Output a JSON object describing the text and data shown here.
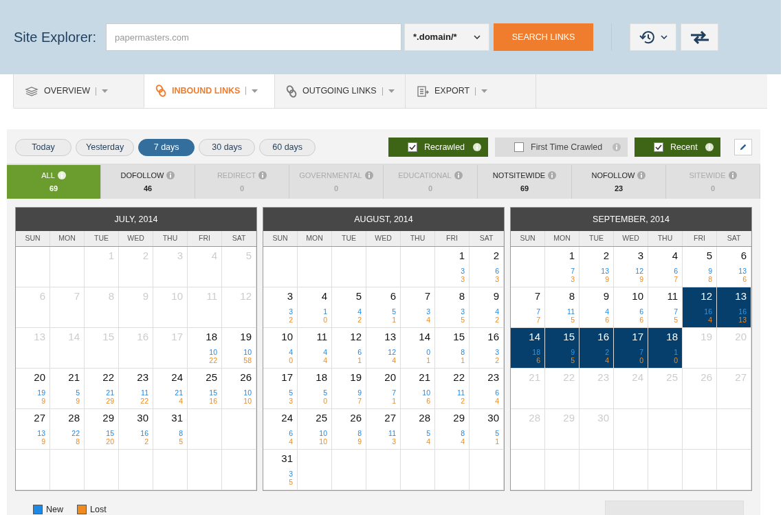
{
  "header": {
    "title": "Site Explorer:",
    "search": {
      "value": "papermasters.com"
    },
    "scope": "*.domain/*",
    "search_button": "SEARCH LINKS"
  },
  "nav_tabs": [
    {
      "label": "OVERVIEW",
      "selected": false
    },
    {
      "label": "INBOUND LINKS",
      "selected": true
    },
    {
      "label": "OUTGOING LINKS",
      "selected": false
    },
    {
      "label": "EXPORT",
      "selected": false
    }
  ],
  "periods": [
    {
      "label": "Today",
      "selected": false
    },
    {
      "label": "Yesterday",
      "selected": false
    },
    {
      "label": "7 days",
      "selected": true
    },
    {
      "label": "30 days",
      "selected": false
    },
    {
      "label": "60 days",
      "selected": false
    }
  ],
  "filters": [
    {
      "label": "Recrawled",
      "checked": true
    },
    {
      "label": "First Time Crawled",
      "checked": false
    },
    {
      "label": "Recent",
      "checked": true
    }
  ],
  "categories": [
    {
      "label": "ALL",
      "count": "69",
      "selected": true,
      "disabled": false
    },
    {
      "label": "DOFOLLOW",
      "count": "46",
      "selected": false,
      "disabled": false
    },
    {
      "label": "REDIRECT",
      "count": "0",
      "selected": false,
      "disabled": true
    },
    {
      "label": "GOVERNMENTAL",
      "count": "0",
      "selected": false,
      "disabled": true
    },
    {
      "label": "EDUCATIONAL",
      "count": "0",
      "selected": false,
      "disabled": true
    },
    {
      "label": "NOTSITEWIDE",
      "count": "69",
      "selected": false,
      "disabled": false
    },
    {
      "label": "NOFOLLOW",
      "count": "23",
      "selected": false,
      "disabled": false
    },
    {
      "label": "SITEWIDE",
      "count": "0",
      "selected": false,
      "disabled": true
    }
  ],
  "months": [
    {
      "title": "JULY, 2014",
      "weekdays": [
        "SUN",
        "MON",
        "TUE",
        "WED",
        "THU",
        "FRI",
        "SAT"
      ],
      "weeks": [
        [
          {
            "kind": "blank"
          },
          {
            "kind": "blank"
          },
          {
            "kind": "inactive",
            "day": "1"
          },
          {
            "kind": "inactive",
            "day": "2"
          },
          {
            "kind": "inactive",
            "day": "3"
          },
          {
            "kind": "inactive",
            "day": "4"
          },
          {
            "kind": "inactive",
            "day": "5"
          }
        ],
        [
          {
            "kind": "inactive",
            "day": "6"
          },
          {
            "kind": "inactive",
            "day": "7"
          },
          {
            "kind": "inactive",
            "day": "8"
          },
          {
            "kind": "inactive",
            "day": "9"
          },
          {
            "kind": "inactive",
            "day": "10"
          },
          {
            "kind": "inactive",
            "day": "11"
          },
          {
            "kind": "inactive",
            "day": "12"
          }
        ],
        [
          {
            "kind": "inactive",
            "day": "13"
          },
          {
            "kind": "inactive",
            "day": "14"
          },
          {
            "kind": "inactive",
            "day": "15"
          },
          {
            "kind": "inactive",
            "day": "16"
          },
          {
            "kind": "inactive",
            "day": "17"
          },
          {
            "kind": "active",
            "day": "18",
            "new": "10",
            "lost": "22",
            "selected": false
          },
          {
            "kind": "active",
            "day": "19",
            "new": "10",
            "lost": "58",
            "selected": false
          }
        ],
        [
          {
            "kind": "active",
            "day": "20",
            "new": "19",
            "lost": "9",
            "selected": false
          },
          {
            "kind": "active",
            "day": "21",
            "new": "5",
            "lost": "9",
            "selected": false
          },
          {
            "kind": "active",
            "day": "22",
            "new": "21",
            "lost": "29",
            "selected": false
          },
          {
            "kind": "active",
            "day": "23",
            "new": "11",
            "lost": "22",
            "selected": false
          },
          {
            "kind": "active",
            "day": "24",
            "new": "21",
            "lost": "4",
            "selected": false
          },
          {
            "kind": "active",
            "day": "25",
            "new": "15",
            "lost": "16",
            "selected": false
          },
          {
            "kind": "active",
            "day": "26",
            "new": "10",
            "lost": "10",
            "selected": false
          }
        ],
        [
          {
            "kind": "active",
            "day": "27",
            "new": "13",
            "lost": "9",
            "selected": false
          },
          {
            "kind": "active",
            "day": "28",
            "new": "22",
            "lost": "8",
            "selected": false
          },
          {
            "kind": "active",
            "day": "29",
            "new": "15",
            "lost": "20",
            "selected": false
          },
          {
            "kind": "active",
            "day": "30",
            "new": "16",
            "lost": "2",
            "selected": false
          },
          {
            "kind": "active",
            "day": "31",
            "new": "8",
            "lost": "5",
            "selected": false
          },
          {
            "kind": "blank"
          },
          {
            "kind": "blank"
          }
        ],
        [
          {
            "kind": "blank"
          },
          {
            "kind": "blank"
          },
          {
            "kind": "blank"
          },
          {
            "kind": "blank"
          },
          {
            "kind": "blank"
          },
          {
            "kind": "blank"
          },
          {
            "kind": "blank"
          }
        ]
      ]
    },
    {
      "title": "AUGUST, 2014",
      "weekdays": [
        "SUN",
        "MON",
        "TUE",
        "WED",
        "THU",
        "FRI",
        "SAT"
      ],
      "weeks": [
        [
          {
            "kind": "blank"
          },
          {
            "kind": "blank"
          },
          {
            "kind": "blank"
          },
          {
            "kind": "blank"
          },
          {
            "kind": "blank"
          },
          {
            "kind": "active",
            "day": "1",
            "new": "3",
            "lost": "3",
            "selected": false
          },
          {
            "kind": "active",
            "day": "2",
            "new": "6",
            "lost": "3",
            "selected": false
          }
        ],
        [
          {
            "kind": "active",
            "day": "3",
            "new": "3",
            "lost": "2",
            "selected": false
          },
          {
            "kind": "active",
            "day": "4",
            "new": "1",
            "lost": "0",
            "selected": false
          },
          {
            "kind": "active",
            "day": "5",
            "new": "4",
            "lost": "2",
            "selected": false
          },
          {
            "kind": "active",
            "day": "6",
            "new": "5",
            "lost": "1",
            "selected": false
          },
          {
            "kind": "active",
            "day": "7",
            "new": "3",
            "lost": "4",
            "selected": false
          },
          {
            "kind": "active",
            "day": "8",
            "new": "3",
            "lost": "5",
            "selected": false
          },
          {
            "kind": "active",
            "day": "9",
            "new": "4",
            "lost": "2",
            "selected": false
          }
        ],
        [
          {
            "kind": "active",
            "day": "10",
            "new": "4",
            "lost": "0",
            "selected": false
          },
          {
            "kind": "active",
            "day": "11",
            "new": "4",
            "lost": "4",
            "selected": false
          },
          {
            "kind": "active",
            "day": "12",
            "new": "6",
            "lost": "1",
            "selected": false
          },
          {
            "kind": "active",
            "day": "13",
            "new": "12",
            "lost": "4",
            "selected": false
          },
          {
            "kind": "active",
            "day": "14",
            "new": "0",
            "lost": "1",
            "selected": false
          },
          {
            "kind": "active",
            "day": "15",
            "new": "8",
            "lost": "1",
            "selected": false
          },
          {
            "kind": "active",
            "day": "16",
            "new": "3",
            "lost": "2",
            "selected": false
          }
        ],
        [
          {
            "kind": "active",
            "day": "17",
            "new": "5",
            "lost": "3",
            "selected": false
          },
          {
            "kind": "active",
            "day": "18",
            "new": "5",
            "lost": "0",
            "selected": false
          },
          {
            "kind": "active",
            "day": "19",
            "new": "9",
            "lost": "7",
            "selected": false
          },
          {
            "kind": "active",
            "day": "20",
            "new": "7",
            "lost": "1",
            "selected": false
          },
          {
            "kind": "active",
            "day": "21",
            "new": "10",
            "lost": "6",
            "selected": false
          },
          {
            "kind": "active",
            "day": "22",
            "new": "11",
            "lost": "2",
            "selected": false
          },
          {
            "kind": "active",
            "day": "23",
            "new": "6",
            "lost": "4",
            "selected": false
          }
        ],
        [
          {
            "kind": "active",
            "day": "24",
            "new": "6",
            "lost": "4",
            "selected": false
          },
          {
            "kind": "active",
            "day": "25",
            "new": "10",
            "lost": "10",
            "selected": false
          },
          {
            "kind": "active",
            "day": "26",
            "new": "8",
            "lost": "9",
            "selected": false
          },
          {
            "kind": "active",
            "day": "27",
            "new": "11",
            "lost": "3",
            "selected": false
          },
          {
            "kind": "active",
            "day": "28",
            "new": "5",
            "lost": "4",
            "selected": false
          },
          {
            "kind": "active",
            "day": "29",
            "new": "8",
            "lost": "4",
            "selected": false
          },
          {
            "kind": "active",
            "day": "30",
            "new": "5",
            "lost": "1",
            "selected": false
          }
        ],
        [
          {
            "kind": "active",
            "day": "31",
            "new": "3",
            "lost": "5",
            "selected": false
          },
          {
            "kind": "blank"
          },
          {
            "kind": "blank"
          },
          {
            "kind": "blank"
          },
          {
            "kind": "blank"
          },
          {
            "kind": "blank"
          },
          {
            "kind": "blank"
          }
        ]
      ]
    },
    {
      "title": "SEPTEMBER, 2014",
      "weekdays": [
        "SUN",
        "MON",
        "TUE",
        "WED",
        "THU",
        "FRI",
        "SAT"
      ],
      "weeks": [
        [
          {
            "kind": "blank"
          },
          {
            "kind": "active",
            "day": "1",
            "new": "7",
            "lost": "3",
            "selected": false
          },
          {
            "kind": "active",
            "day": "2",
            "new": "13",
            "lost": "9",
            "selected": false
          },
          {
            "kind": "active",
            "day": "3",
            "new": "12",
            "lost": "9",
            "selected": false
          },
          {
            "kind": "active",
            "day": "4",
            "new": "6",
            "lost": "7",
            "selected": false
          },
          {
            "kind": "active",
            "day": "5",
            "new": "9",
            "lost": "8",
            "selected": false
          },
          {
            "kind": "active",
            "day": "6",
            "new": "13",
            "lost": "6",
            "selected": false
          }
        ],
        [
          {
            "kind": "active",
            "day": "7",
            "new": "7",
            "lost": "7",
            "selected": false
          },
          {
            "kind": "active",
            "day": "8",
            "new": "11",
            "lost": "5",
            "selected": false
          },
          {
            "kind": "active",
            "day": "9",
            "new": "4",
            "lost": "6",
            "selected": false
          },
          {
            "kind": "active",
            "day": "10",
            "new": "6",
            "lost": "6",
            "selected": false
          },
          {
            "kind": "active",
            "day": "11",
            "new": "7",
            "lost": "5",
            "selected": false
          },
          {
            "kind": "active",
            "day": "12",
            "new": "16",
            "lost": "4",
            "selected": true
          },
          {
            "kind": "active",
            "day": "13",
            "new": "16",
            "lost": "13",
            "selected": true
          }
        ],
        [
          {
            "kind": "active",
            "day": "14",
            "new": "18",
            "lost": "6",
            "selected": true
          },
          {
            "kind": "active",
            "day": "15",
            "new": "9",
            "lost": "5",
            "selected": true
          },
          {
            "kind": "active",
            "day": "16",
            "new": "2",
            "lost": "4",
            "selected": true
          },
          {
            "kind": "active",
            "day": "17",
            "new": "7",
            "lost": "0",
            "selected": true
          },
          {
            "kind": "active",
            "day": "18",
            "new": "1",
            "lost": "0",
            "selected": true
          },
          {
            "kind": "inactive",
            "day": "19"
          },
          {
            "kind": "inactive",
            "day": "20"
          }
        ],
        [
          {
            "kind": "inactive",
            "day": "21"
          },
          {
            "kind": "inactive",
            "day": "22"
          },
          {
            "kind": "inactive",
            "day": "23"
          },
          {
            "kind": "inactive",
            "day": "24"
          },
          {
            "kind": "inactive",
            "day": "25"
          },
          {
            "kind": "inactive",
            "day": "26"
          },
          {
            "kind": "inactive",
            "day": "27"
          }
        ],
        [
          {
            "kind": "inactive",
            "day": "28"
          },
          {
            "kind": "inactive",
            "day": "29"
          },
          {
            "kind": "inactive",
            "day": "30"
          },
          {
            "kind": "blank"
          },
          {
            "kind": "blank"
          },
          {
            "kind": "blank"
          },
          {
            "kind": "blank"
          }
        ],
        [
          {
            "kind": "blank"
          },
          {
            "kind": "blank"
          },
          {
            "kind": "blank"
          },
          {
            "kind": "blank"
          },
          {
            "kind": "blank"
          },
          {
            "kind": "blank"
          },
          {
            "kind": "blank"
          }
        ]
      ]
    }
  ],
  "legend": [
    {
      "label": "New",
      "color": "#1e88e5"
    },
    {
      "label": "Lost",
      "color": "#ef8a1f"
    }
  ]
}
